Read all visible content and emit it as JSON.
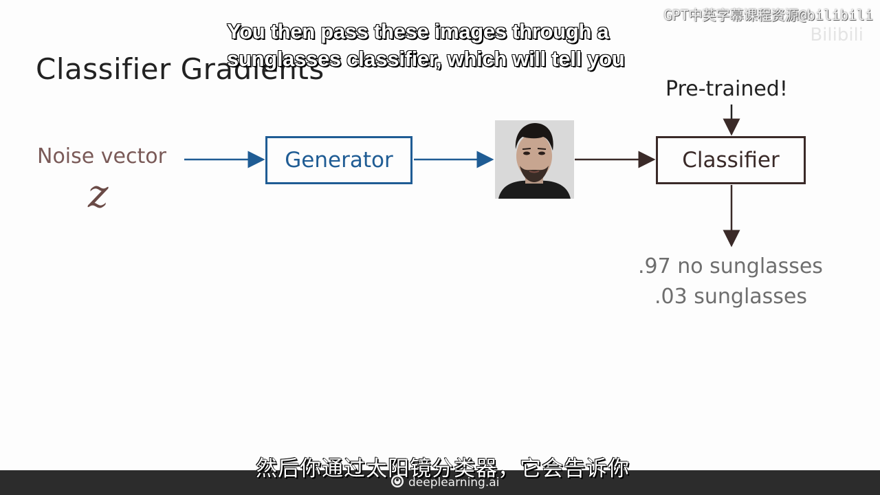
{
  "slide": {
    "title": "Classifier Gradients"
  },
  "watermark": {
    "text": "GPT中英字幕课程资源@bilibili",
    "ghost": "Bilibili"
  },
  "subtitles": {
    "en_line1": "You then pass these images through a",
    "en_line2": "sunglasses classifier, which will tell you",
    "zh": "然后你通过太阳镜分类器，它会告诉你"
  },
  "diagram": {
    "noise_label": "Noise vector",
    "noise_symbol": "z",
    "generator_label": "Generator",
    "classifier_label": "Classifier",
    "pretrained_label": "Pre-trained!",
    "output_line1": ".97 no sunglasses",
    "output_line2": ".03 sunglasses",
    "colors": {
      "generator": "#1f5c94",
      "classifier": "#3a2a28",
      "noise": "#7a5a58",
      "output": "#6e6e6e"
    }
  },
  "footer": {
    "brand": "deeplearning.ai",
    "brand_icon": "deeplearning-logo-icon"
  }
}
